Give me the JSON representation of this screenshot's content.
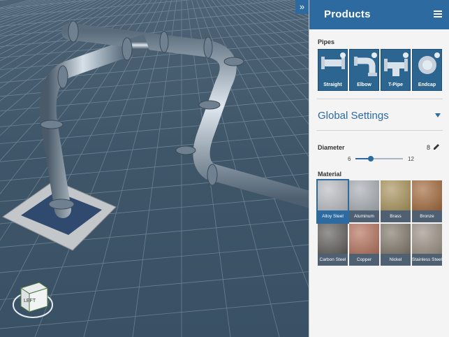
{
  "panel": {
    "title": "Products",
    "pipes_label": "Pipes",
    "pipes": [
      {
        "label": "Straight",
        "icon": "straight-pipe-icon"
      },
      {
        "label": "Elbow",
        "icon": "elbow-pipe-icon"
      },
      {
        "label": "T-Pipe",
        "icon": "t-pipe-icon"
      },
      {
        "label": "Endcap",
        "icon": "endcap-pipe-icon"
      }
    ],
    "global_settings": "Global Settings",
    "diameter": {
      "label": "Diameter",
      "value": "8",
      "min": "6",
      "max": "12",
      "level": 0.33
    },
    "material_label": "Material",
    "materials": [
      {
        "label": "Alloy Steel",
        "color": "#b9bcc1",
        "selected": true
      },
      {
        "label": "Aluminum",
        "color": "#a7adb3"
      },
      {
        "label": "Brass",
        "color": "#a8925a"
      },
      {
        "label": "Bronze",
        "color": "#a0683a"
      },
      {
        "label": "Carbon Steel",
        "color": "#5f5c59"
      },
      {
        "label": "Copper",
        "color": "#b3705b"
      },
      {
        "label": "Nickel",
        "color": "#7f7669"
      },
      {
        "label": "Stainless Steel",
        "color": "#9a8f83"
      }
    ]
  },
  "viewport": {
    "nav_cube_face": "LEFT",
    "collapse_icon": "double-chevron-right-icon"
  },
  "colors": {
    "accent": "#2c6aa0",
    "grid": "#8fa3b3"
  }
}
